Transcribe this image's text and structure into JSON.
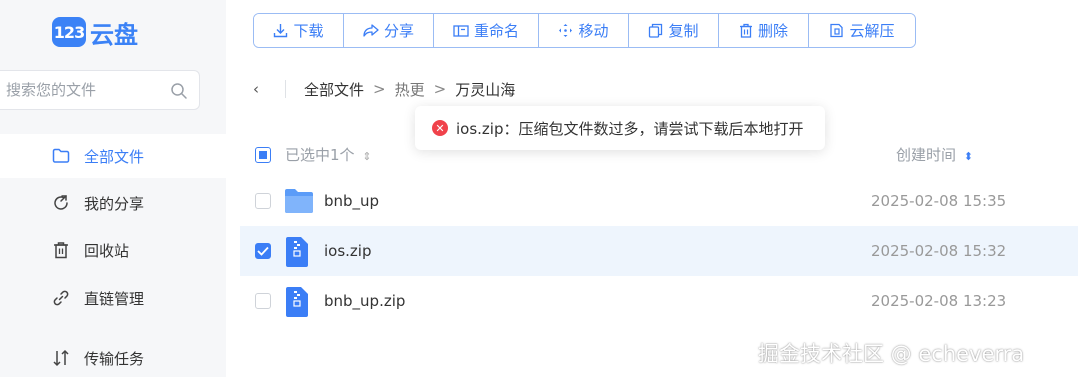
{
  "app": {
    "logo_badge": "123",
    "logo_text": "云盘"
  },
  "sidebar": {
    "search_placeholder": "搜索您的文件",
    "items": [
      {
        "label": "全部文件",
        "icon": "folder-icon",
        "active": true
      },
      {
        "label": "我的分享",
        "icon": "share-icon",
        "active": false
      },
      {
        "label": "回收站",
        "icon": "trash-icon",
        "active": false
      },
      {
        "label": "直链管理",
        "icon": "link-icon",
        "active": false
      },
      {
        "label": "传输任务",
        "icon": "transfer-icon",
        "active": false
      }
    ]
  },
  "toolbar": {
    "download": "下载",
    "share": "分享",
    "rename": "重命名",
    "move": "移动",
    "copy": "复制",
    "delete": "删除",
    "unzip": "云解压"
  },
  "breadcrumb": {
    "back": "‹",
    "root": "全部文件",
    "level1": "热更",
    "current": "万灵山海",
    "sep": ">"
  },
  "toast": {
    "type": "error",
    "message": "ios.zip：压缩包文件数过多，请尝试下载后本地打开"
  },
  "list": {
    "header_selected": "已选中1个",
    "header_time": "创建时间",
    "rows": [
      {
        "name": "bnb_up",
        "type": "folder",
        "date": "2025-02-08 15:35",
        "checked": false
      },
      {
        "name": "ios.zip",
        "type": "zip",
        "date": "2025-02-08 15:32",
        "checked": true
      },
      {
        "name": "bnb_up.zip",
        "type": "zip",
        "date": "2025-02-08 13:23",
        "checked": false
      }
    ]
  },
  "watermark": "掘金技术社区 @ echeverra",
  "colors": {
    "accent": "#3b7ef6",
    "error": "#f0424b",
    "sidebar_bg": "#f6f7f9",
    "selected_row": "#eef5fd"
  }
}
